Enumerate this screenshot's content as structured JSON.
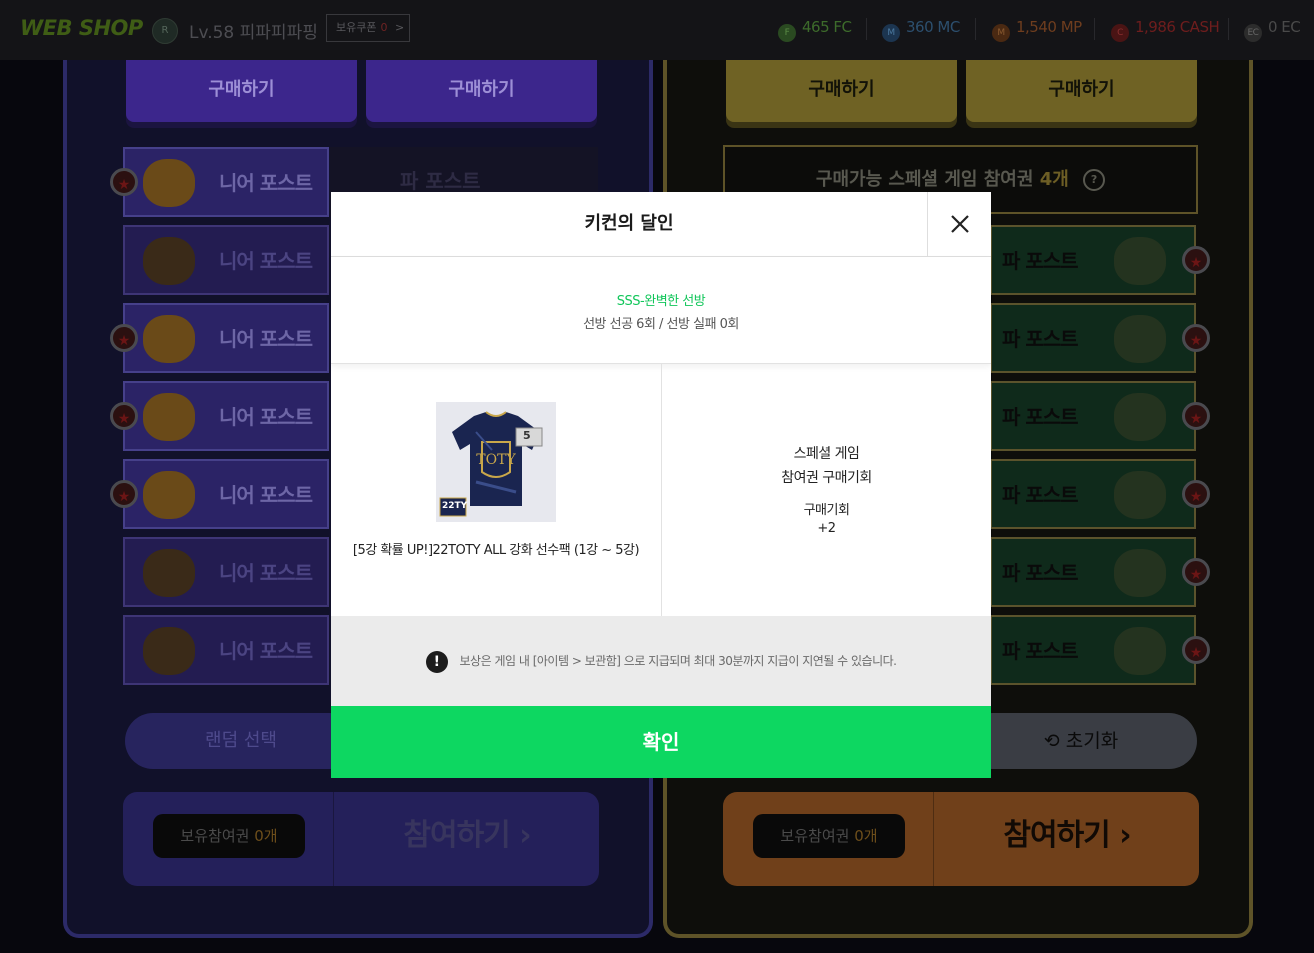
{
  "header": {
    "logo": "WEB SHOP",
    "rank_badge": "R",
    "user_level": "Lv.58 피파피파핑",
    "coupon_label": "보유쿠폰",
    "coupon_count": "0",
    "coupon_arrow": ">",
    "currencies": [
      {
        "icon": "F",
        "label": "465 FC",
        "color": "#3d6b2b"
      },
      {
        "icon": "M",
        "label": "360 MC",
        "color": "#2c4f6e"
      },
      {
        "icon": "M",
        "label": "1,540 MP",
        "color": "#6e3d1e"
      },
      {
        "icon": "C",
        "label": "1,986 CASH",
        "color": "#6e1d1d"
      },
      {
        "icon": "EC",
        "label": "0 EC",
        "color": "#4a4a4a"
      }
    ]
  },
  "background": {
    "buy_label": "구매하기",
    "near_post": "니어 포스트",
    "far_post": "파 포스트",
    "ticket_text": "구매가능 스페셜 게임 참여권",
    "ticket_count": "4개",
    "help_icon": "?",
    "random_select": "랜덤 선택",
    "reset": "초기화",
    "reset_icon": "⟲",
    "hold_ticket_label": "보유참여권",
    "hold_ticket_count": "0개",
    "join": "참여하기",
    "join_arrow": "›",
    "star": "★"
  },
  "modal": {
    "title": "키컨의 달인",
    "close_icon": "close-icon",
    "result_grade": "SSS-완벽한 선방",
    "result_stats": "선방 선공 6회 / 선방 실패 0회",
    "item_badge": "5",
    "item_tag": "22TY",
    "item_name": "[5강 확률 UP!]22TOTY ALL 강화 선수팩 (1강 ~ 5강)",
    "special_line1": "스페셜 게임",
    "special_line2": "참여권 구매기회",
    "purchase_chance_label": "구매기회",
    "purchase_chance_value": "+2",
    "notice_icon": "!",
    "notice_text": "보상은 게임 내 [아이템 > 보관함] 으로 지급되며 최대 30분까지 지급이 지연될 수 있습니다.",
    "confirm": "확인"
  }
}
